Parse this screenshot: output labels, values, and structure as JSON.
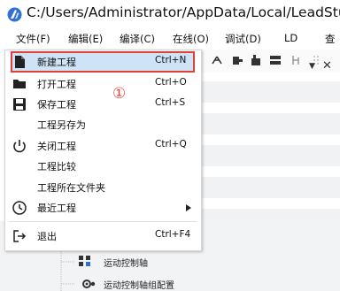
{
  "window": {
    "title": "C:/Users/Administrator/AppData/Local/LeadStu"
  },
  "menubar": {
    "items": [
      "文件(F)",
      "编辑(E)",
      "编译(C)",
      "在线(O)",
      "调试(D)",
      "LD",
      "查"
    ]
  },
  "file_menu": {
    "items": [
      {
        "label": "新建工程",
        "shortcut": "Ctrl+N",
        "icon": "new-file-icon"
      },
      {
        "label": "打开工程",
        "shortcut": "Ctrl+O",
        "icon": "folder-open-icon"
      },
      {
        "label": "保存工程",
        "shortcut": "Ctrl+S",
        "icon": "save-icon"
      },
      {
        "label": "工程另存为",
        "shortcut": "",
        "icon": ""
      },
      {
        "label": "关闭工程",
        "shortcut": "Ctrl+Q",
        "icon": "power-icon"
      },
      {
        "label": "工程比较",
        "shortcut": "",
        "icon": ""
      },
      {
        "label": "工程所在文件夹",
        "shortcut": "",
        "icon": ""
      },
      {
        "label": "最近工程",
        "shortcut": "",
        "icon": "clock-icon",
        "submenu": true
      },
      {
        "label": "退出",
        "shortcut": "Ctrl+F4",
        "icon": "exit-icon"
      }
    ],
    "highlighted_index": 0
  },
  "annotation": {
    "marker": "①",
    "color": "#e8453c"
  },
  "project_tree": {
    "items": [
      "运动控制轴",
      "运动控制轴组配置"
    ]
  },
  "pane": {
    "close_glyph": "✕",
    "dropdown_glyph": "▼"
  },
  "colors": {
    "highlight_fill": "#cfe3f7",
    "highlight_border": "#e0403a",
    "logo": "#2f6fd6"
  }
}
